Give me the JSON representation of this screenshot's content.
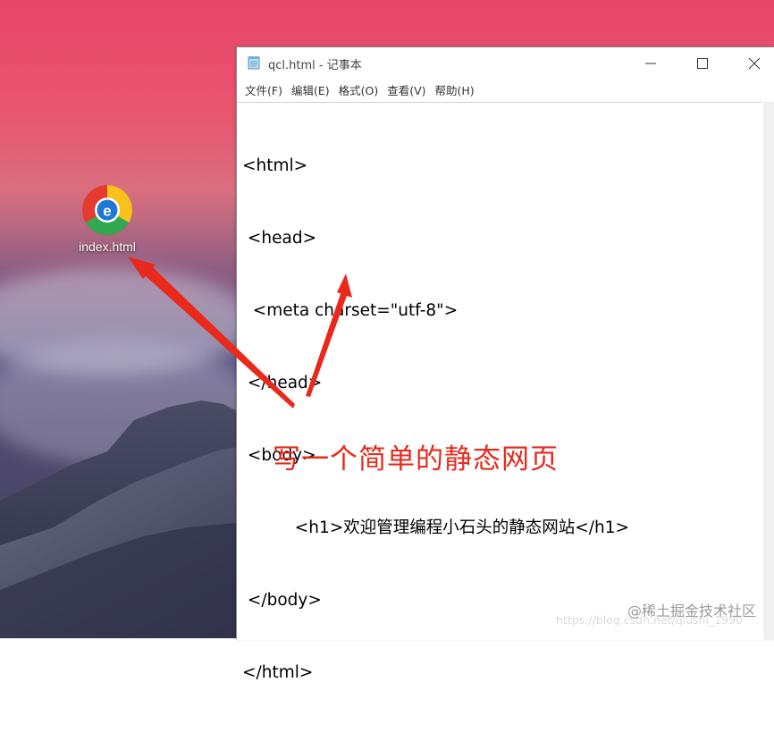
{
  "desktop": {
    "icon_label": "index.html",
    "icon_name": "browser-e-icon"
  },
  "window": {
    "title": "qcl.html - 记事本",
    "controls": {
      "minimize": "minimize-icon",
      "maximize": "maximize-icon",
      "close": "close-icon"
    }
  },
  "menu": {
    "items": [
      "文件(F)",
      "编辑(E)",
      "格式(O)",
      "查看(V)",
      "帮助(H)"
    ]
  },
  "editor": {
    "lines": [
      "<html>",
      " <head>",
      "  <meta charset=\"utf-8\">",
      " </head>",
      " <body>",
      "          <h1>欢迎管理编程小石头的静态网站</h1>",
      " </body>",
      "</html>"
    ]
  },
  "annotation": {
    "text": "写一个简单的静态网页",
    "color": "#e8291c"
  },
  "watermark": {
    "text": "@稀土掘金技术社区",
    "faint_text": "https://blog.csdn.net/qiushi_1990"
  },
  "colors": {
    "arrow": "#e8291c",
    "window_bg": "#ffffff"
  }
}
